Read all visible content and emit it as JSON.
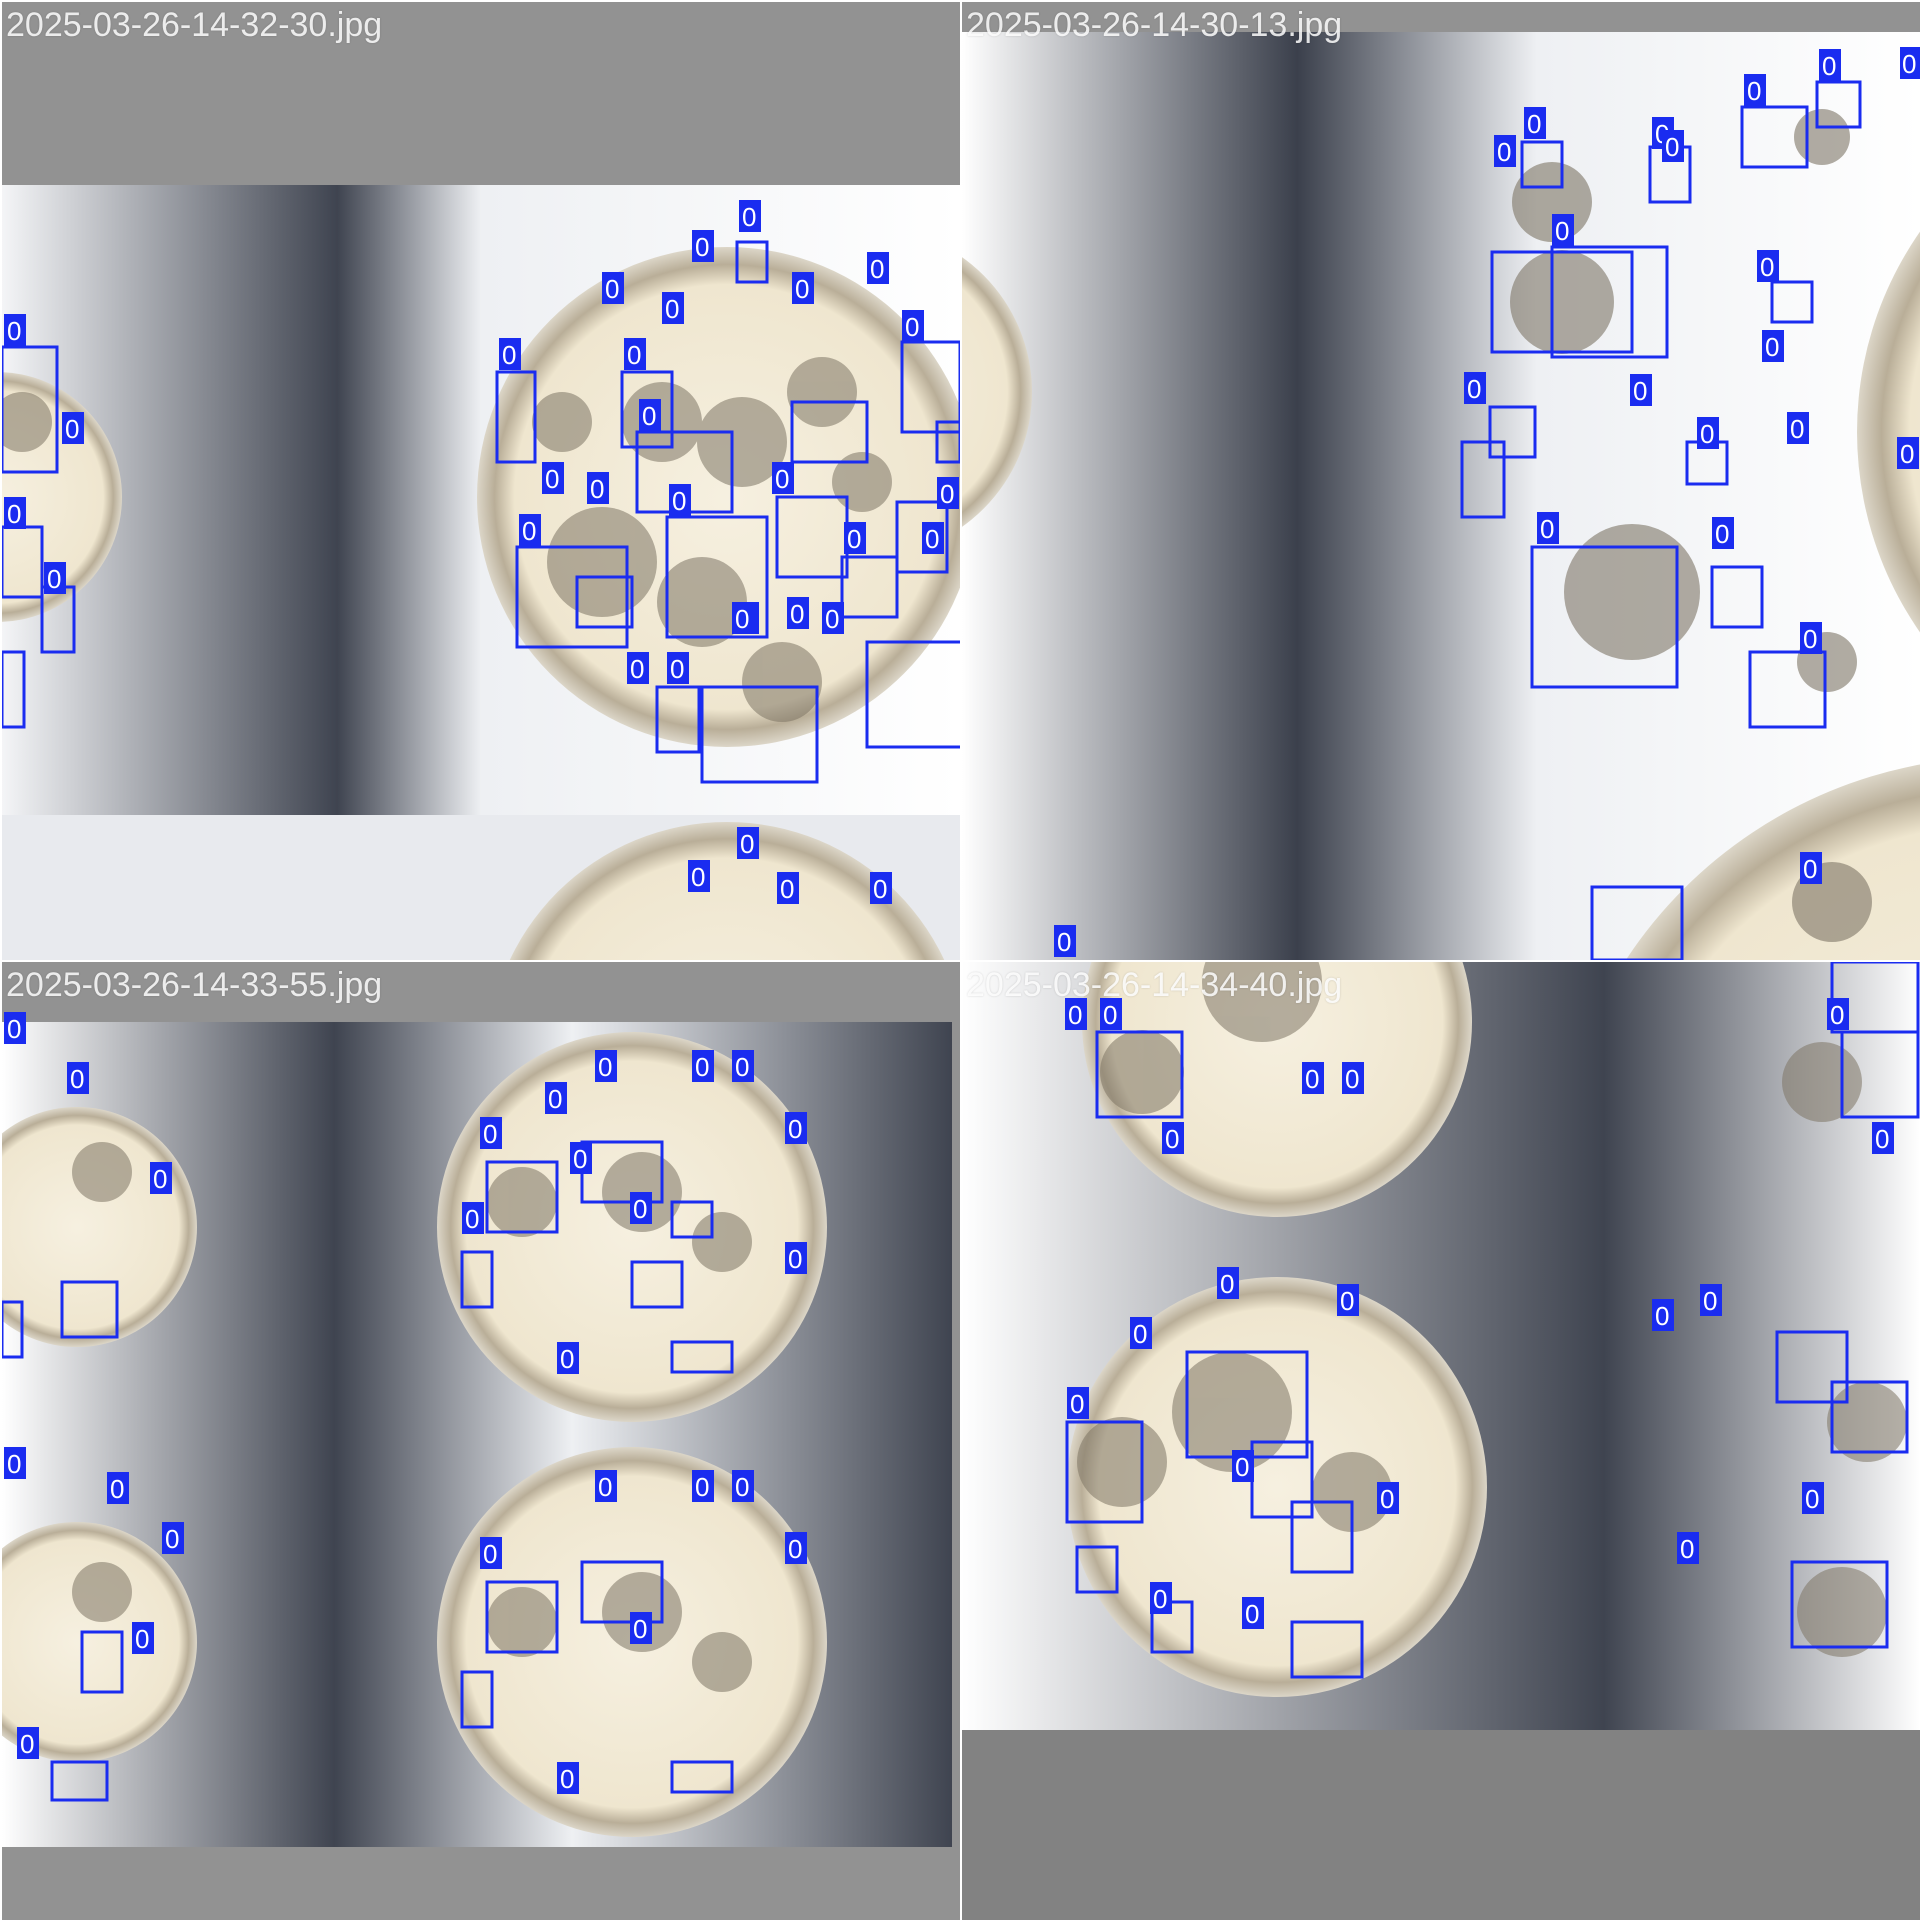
{
  "mosaic": {
    "tiles": [
      {
        "caption": "2025-03-26-14-32-30.jpg"
      },
      {
        "caption": "2025-03-26-14-30-13.jpg"
      },
      {
        "caption": "2025-03-26-14-33-55.jpg"
      },
      {
        "caption": "2025-03-26-14-34-40.jpg"
      }
    ],
    "detection_label": "0",
    "box_color": "#1a2cf0",
    "background_color": "#929292"
  }
}
